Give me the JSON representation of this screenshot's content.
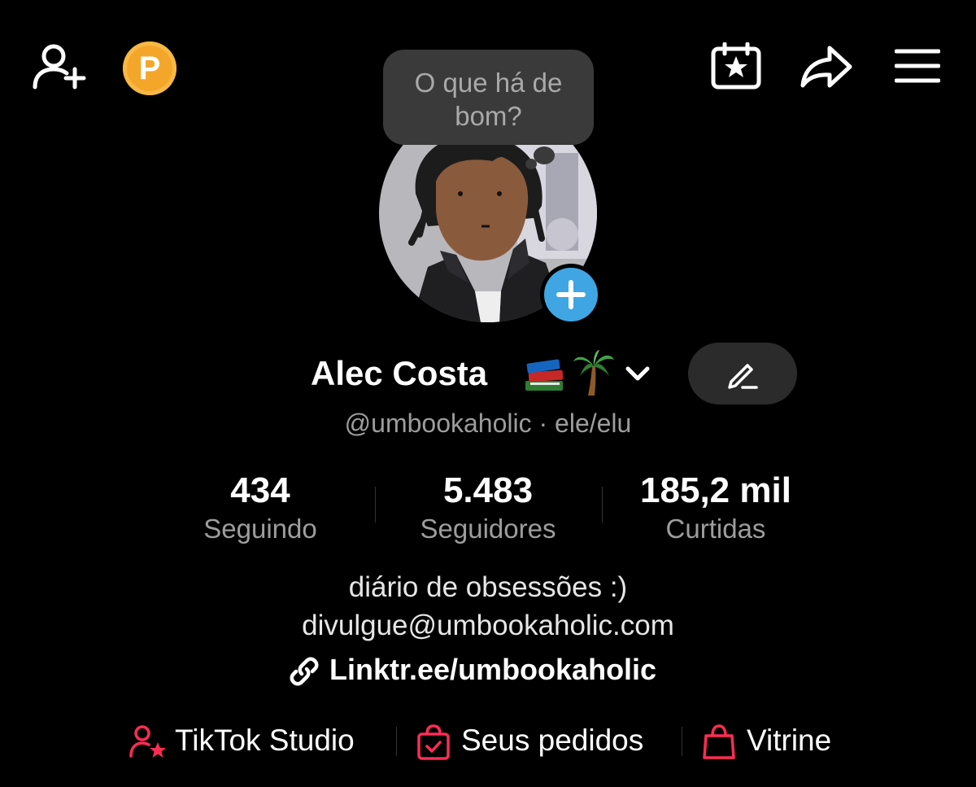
{
  "header": {
    "add_friend_icon": "person-plus-icon",
    "coin_label": "P",
    "calendar_icon": "calendar-star-icon",
    "share_icon": "share-arrow-icon",
    "menu_icon": "hamburger-menu-icon"
  },
  "bubble": {
    "line1": "O que há de",
    "line2": "bom?"
  },
  "profile": {
    "name": "Alec Costa",
    "emojis": [
      "📚",
      "🌴"
    ],
    "handle": "@umbookaholic · ele/elu",
    "edit_icon": "pencil-icon",
    "add_avatar_icon": "plus-icon"
  },
  "stats": [
    {
      "value": "434",
      "label": "Seguindo"
    },
    {
      "value": "5.483",
      "label": "Seguidores"
    },
    {
      "value": "185,2 mil",
      "label": "Curtidas"
    }
  ],
  "bio": {
    "line1": "diário de obsessões :)",
    "line2": "divulgue@umbookaholic.com",
    "link": "Linktr.ee/umbookaholic"
  },
  "tools": [
    {
      "label": "TikTok Studio",
      "icon": "person-star-icon"
    },
    {
      "label": "Seus pedidos",
      "icon": "order-bag-check-icon"
    },
    {
      "label": "Vitrine",
      "icon": "shopping-bag-icon"
    }
  ],
  "colors": {
    "background": "#000000",
    "accent_red": "#fe2c55",
    "coin": "#f4a62a",
    "add_blue": "#3fa6e3",
    "muted_text": "#9d9d9d"
  }
}
